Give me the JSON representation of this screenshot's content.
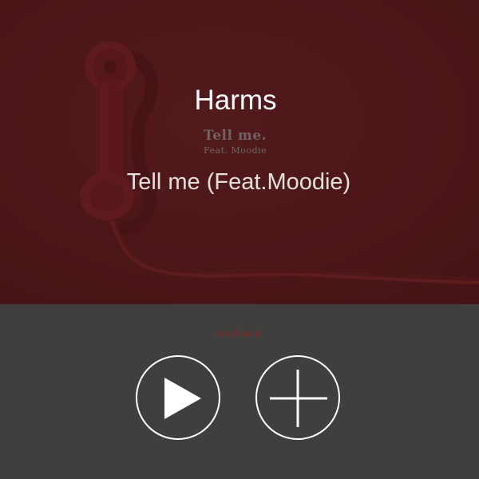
{
  "cover": {
    "album_title": "Tell me.",
    "album_subtitle": "Feat. Moodie"
  },
  "player": {
    "artist": "Harms",
    "track": "Tell me (Feat.Moodie)",
    "brand": "HARMS"
  },
  "icons": {
    "play": "play-icon",
    "add": "plus-icon"
  },
  "colors": {
    "cover_background": "#4b1a1c",
    "controls_background": "#413e3e",
    "brand_text": "#8b2525",
    "icon": "#ffffff"
  }
}
